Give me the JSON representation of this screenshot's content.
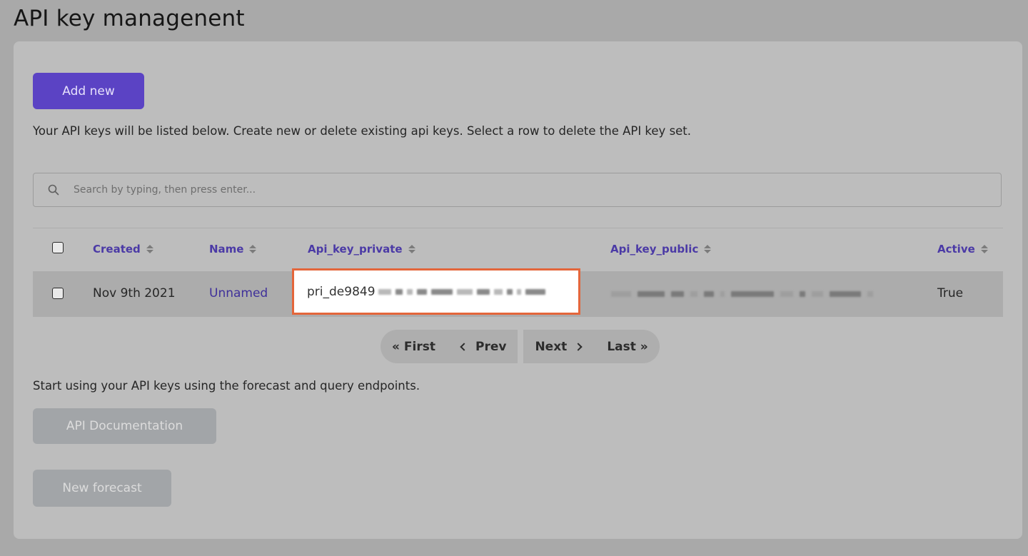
{
  "page": {
    "title": "API key managenent"
  },
  "actions": {
    "add_new_label": "Add new",
    "intro_text": "Your API keys will be listed below. Create new or delete existing api keys. Select a row to delete the API key set."
  },
  "search": {
    "placeholder": "Search by typing, then press enter..."
  },
  "table": {
    "columns": [
      "Created",
      "Name",
      "Api_key_private",
      "Api_key_public",
      "Active"
    ],
    "rows": [
      {
        "created": "Nov 9th 2021",
        "name": "Unnamed",
        "api_key_private": "pri_de9849",
        "api_key_public": "",
        "active": "True"
      }
    ]
  },
  "pagination": {
    "first_label": "« First",
    "prev_label": "Prev",
    "next_label": "Next",
    "last_label": "Last »"
  },
  "footer": {
    "outro_text": "Start using your API keys using the forecast and query endpoints.",
    "docs_label": "API Documentation",
    "forecast_label": "New forecast"
  },
  "colors": {
    "primary": "#5b43c4",
    "highlight_border": "#e4663b",
    "link": "#4b3aa6"
  }
}
